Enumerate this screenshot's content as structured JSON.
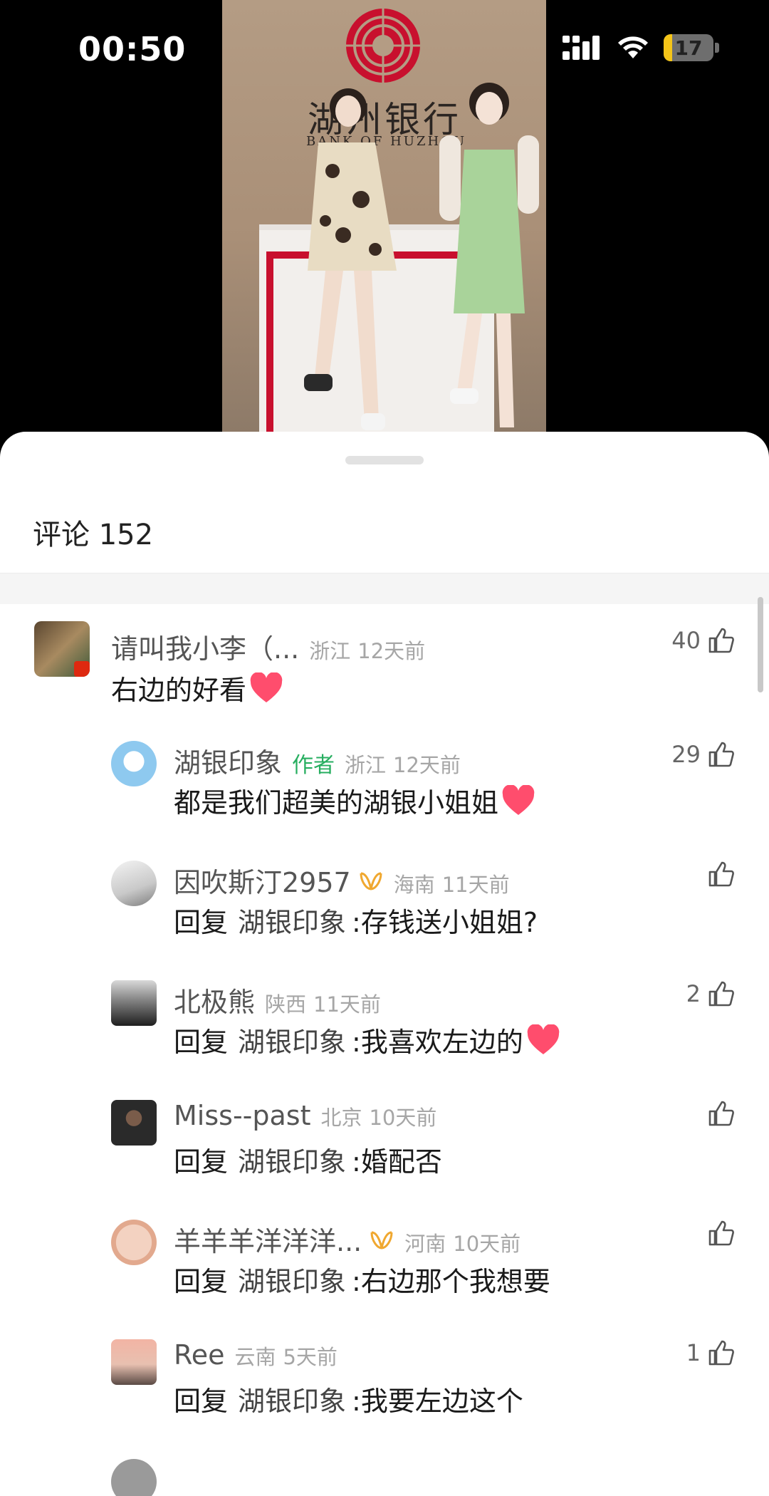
{
  "status_bar": {
    "time": "00:50",
    "battery": "17",
    "battery_level": 0.17,
    "icons": [
      "signal-icon",
      "wifi-icon",
      "battery-icon"
    ]
  },
  "video": {
    "bank_name": "湖州银行",
    "bank_en": "BANK OF HUZHOU"
  },
  "comments_sheet": {
    "title": "评论 152",
    "reply_prefix": "回复",
    "reply_target": "湖银印象",
    "comments": [
      {
        "name": "请叫我小李（...",
        "location": "浙江",
        "time": "12天前",
        "text": "右边的好看",
        "likes": "40",
        "heart": true
      },
      {
        "name": "湖银印象",
        "author_tag": "作者",
        "location": "浙江",
        "time": "12天前",
        "text": "都是我们超美的湖银小姐姐",
        "likes": "29",
        "heart": true
      },
      {
        "name": "因吹斯汀2957",
        "location": "海南",
        "time": "11天前",
        "text": ":存钱送小姐姐?",
        "likes": ""
      },
      {
        "name": "北极熊",
        "location": "陕西",
        "time": "11天前",
        "text": ":我喜欢左边的",
        "likes": "2",
        "heart": true
      },
      {
        "name": "Miss--past",
        "location": "北京",
        "time": "10天前",
        "text": ":婚配否",
        "likes": ""
      },
      {
        "name": "羊羊羊洋洋洋...",
        "location": "河南",
        "time": "10天前",
        "text": ":右边那个我想要",
        "likes": ""
      },
      {
        "name": "Ree",
        "location": "云南",
        "time": "5天前",
        "text": ":我要左边这个",
        "likes": "1"
      }
    ]
  },
  "colors": {
    "author_tag": "#27ae60",
    "meta_gray": "#a6a6a6",
    "heart": "#ff4d6d",
    "vip": "#f0a830",
    "battery": "#f5c518"
  }
}
